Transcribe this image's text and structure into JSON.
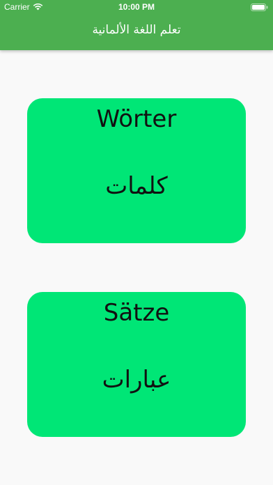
{
  "status_bar": {
    "carrier": "Carrier",
    "time": "10:00 PM",
    "wifi_icon": "wifi-icon",
    "battery_icon": "battery-icon"
  },
  "header": {
    "title": "تعلم اللغة الألمانية"
  },
  "cards": [
    {
      "german": "Wörter",
      "arabic": "كلمات"
    },
    {
      "german": "Sätze",
      "arabic": "عبارات"
    }
  ],
  "colors": {
    "header": "#4caf50",
    "card": "#00e676",
    "background": "#f9f9f9",
    "text": "#111111"
  }
}
